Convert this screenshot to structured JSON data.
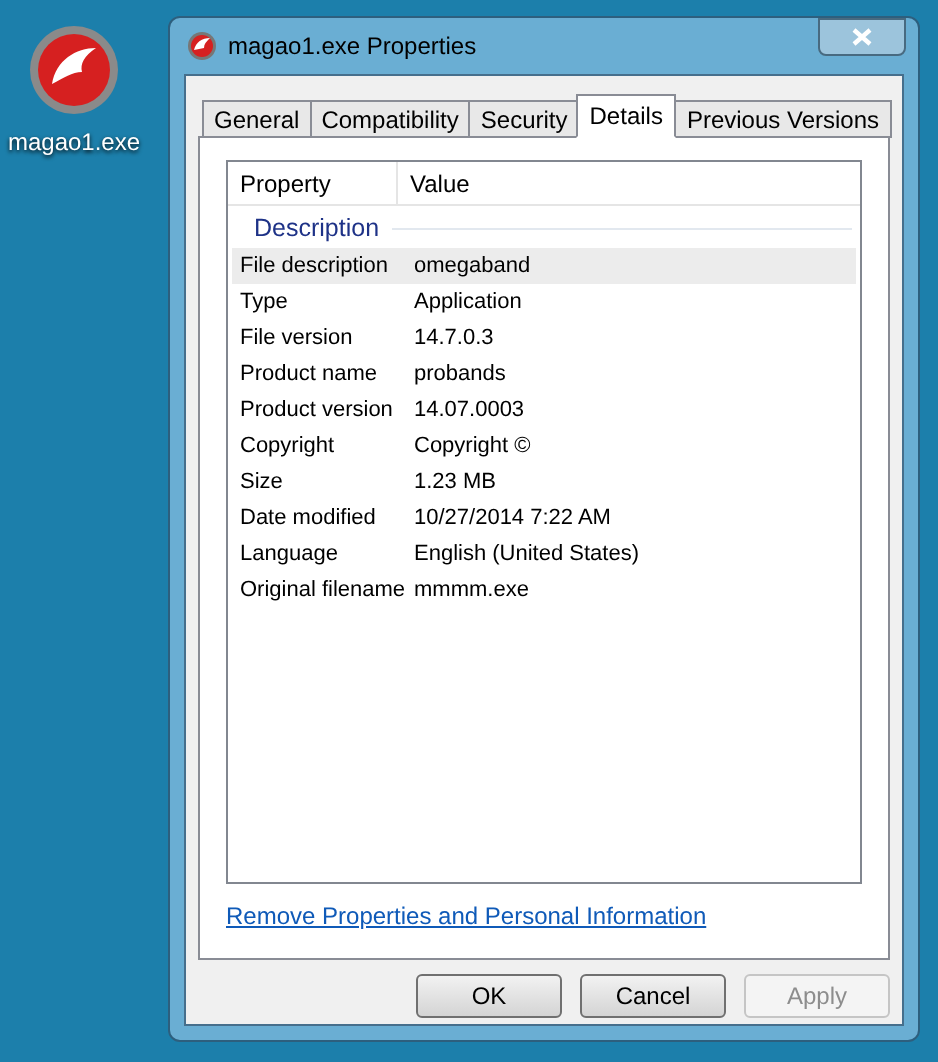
{
  "desktop_icon": {
    "label": "magao1.exe"
  },
  "window": {
    "title": "magao1.exe Properties"
  },
  "tabs": [
    {
      "label": "General",
      "selected": false
    },
    {
      "label": "Compatibility",
      "selected": false
    },
    {
      "label": "Security",
      "selected": false
    },
    {
      "label": "Details",
      "selected": true
    },
    {
      "label": "Previous Versions",
      "selected": false
    }
  ],
  "table": {
    "columns": [
      "Property",
      "Value"
    ],
    "group": "Description",
    "rows": [
      {
        "property": "File description",
        "value": "omegaband",
        "selected": true
      },
      {
        "property": "Type",
        "value": "Application",
        "selected": false
      },
      {
        "property": "File version",
        "value": "14.7.0.3",
        "selected": false
      },
      {
        "property": "Product name",
        "value": "probands",
        "selected": false
      },
      {
        "property": "Product version",
        "value": "14.07.0003",
        "selected": false
      },
      {
        "property": "Copyright",
        "value": "Copyright ©",
        "selected": false
      },
      {
        "property": "Size",
        "value": "1.23 MB",
        "selected": false
      },
      {
        "property": "Date modified",
        "value": "10/27/2014 7:22 AM",
        "selected": false
      },
      {
        "property": "Language",
        "value": "English (United States)",
        "selected": false
      },
      {
        "property": "Original filename",
        "value": "mmmm.exe",
        "selected": false
      }
    ]
  },
  "link": "Remove Properties and Personal Information",
  "buttons": [
    {
      "label": "OK",
      "disabled": false
    },
    {
      "label": "Cancel",
      "disabled": false
    },
    {
      "label": "Apply",
      "disabled": true
    }
  ]
}
